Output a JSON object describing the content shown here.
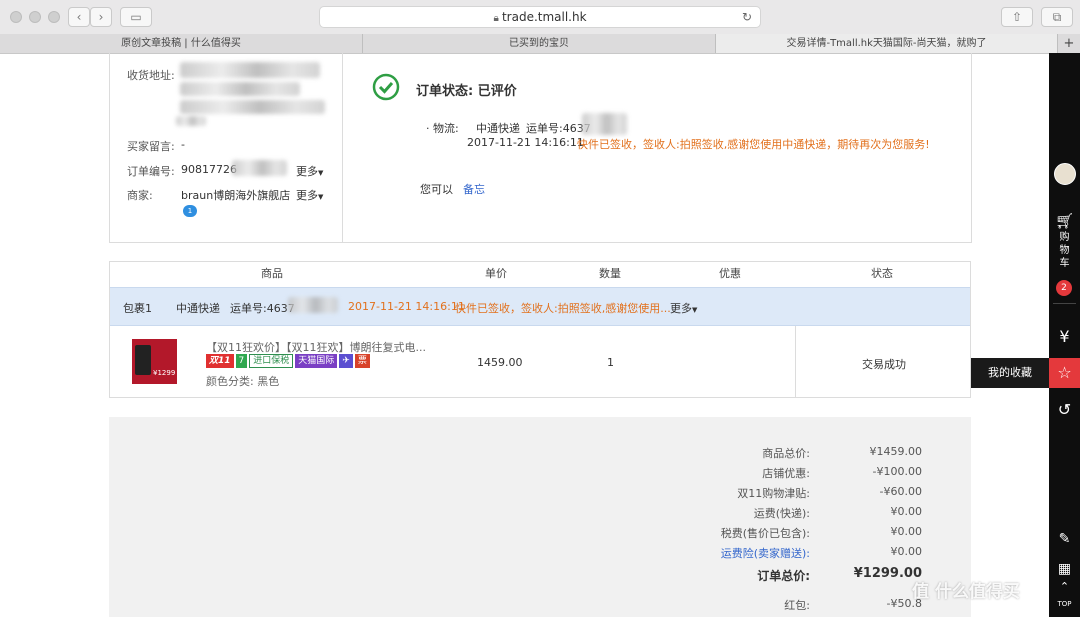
{
  "browser": {
    "url": "trade.tmall.hk",
    "tabs": [
      "原创文章投稿 | 什么值得买",
      "已买到的宝贝",
      "交易详情-Tmall.hk天猫国际-尚天猫，就购了"
    ],
    "new_tab": "+"
  },
  "order_info": {
    "address_label": "收货地址:",
    "remark_label": "买家留言:",
    "remark_value": "-",
    "order_no_label": "订单编号:",
    "order_no_value": "90817726",
    "more": "更多",
    "seller_label": "商家:",
    "seller_value": "braun博朗海外旗舰店",
    "seller_badge": "1"
  },
  "status": {
    "title": "订单状态: 已评价",
    "logistics_label": "· 物流:",
    "carrier": "中通快递",
    "tracking_label": "运单号:4637",
    "time": "2017-11-21 14:16:11",
    "message": "快件已签收，签收人:拍照签收,感谢您使用中通快递，期待再次为您服务!",
    "can_do_label": "您可以",
    "memo_link": "备忘"
  },
  "table": {
    "headers": [
      "商品",
      "单价",
      "数量",
      "优惠",
      "状态"
    ],
    "package": {
      "label": "包裹1",
      "carrier": "中通快递",
      "tracking": "运单号:4637",
      "time": "2017-11-21 14:16:11",
      "message": "快件已签收，签收人:拍照签收,感谢您使用...",
      "more": "更多"
    },
    "item": {
      "title": "【双11狂欢价】【双11狂欢】博朗往复式电...",
      "tags": [
        "双11",
        "7",
        "进口保税",
        "天猫国际",
        "✈",
        "票"
      ],
      "option": "颜色分类:  黑色",
      "price": "1459.00",
      "qty": "1",
      "status": "交易成功",
      "thumb_price": "¥1299"
    }
  },
  "summary": {
    "rows": [
      {
        "label": "商品总价:",
        "value": "¥1459.00"
      },
      {
        "label": "店铺优惠:",
        "value": "-¥100.00"
      },
      {
        "label": "双11购物津贴:",
        "value": "-¥60.00"
      },
      {
        "label": "运费(快递):",
        "value": "¥0.00"
      },
      {
        "label": "税费(售价已包含):",
        "value": "¥0.00"
      },
      {
        "label": "运费险(卖家赠送):",
        "value": "¥0.00"
      }
    ],
    "total_label": "订单总价:",
    "total_value": "¥1299.00",
    "redpacket_label": "红包:",
    "redpacket_value": "-¥50.8"
  },
  "sidebar": {
    "cart_label": "购物车",
    "cart_count": "2",
    "fav_tooltip": "我的收藏",
    "top_label": "TOP"
  },
  "watermark": "值 什么值得买"
}
